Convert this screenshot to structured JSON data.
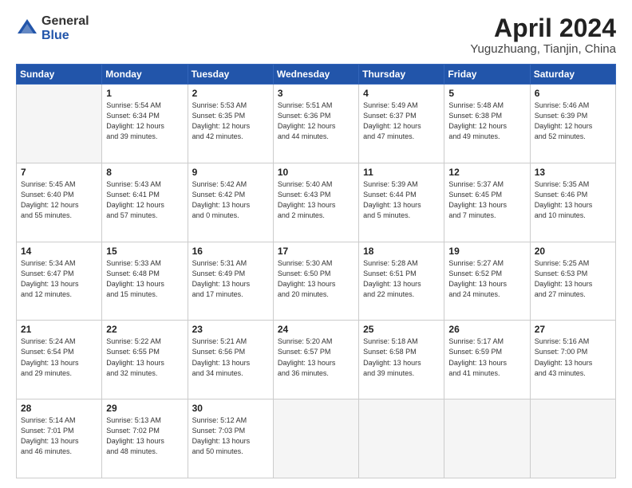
{
  "logo": {
    "general": "General",
    "blue": "Blue"
  },
  "title": "April 2024",
  "location": "Yuguzhuang, Tianjin, China",
  "weekdays": [
    "Sunday",
    "Monday",
    "Tuesday",
    "Wednesday",
    "Thursday",
    "Friday",
    "Saturday"
  ],
  "weeks": [
    [
      {
        "day": "",
        "info": ""
      },
      {
        "day": "1",
        "info": "Sunrise: 5:54 AM\nSunset: 6:34 PM\nDaylight: 12 hours\nand 39 minutes."
      },
      {
        "day": "2",
        "info": "Sunrise: 5:53 AM\nSunset: 6:35 PM\nDaylight: 12 hours\nand 42 minutes."
      },
      {
        "day": "3",
        "info": "Sunrise: 5:51 AM\nSunset: 6:36 PM\nDaylight: 12 hours\nand 44 minutes."
      },
      {
        "day": "4",
        "info": "Sunrise: 5:49 AM\nSunset: 6:37 PM\nDaylight: 12 hours\nand 47 minutes."
      },
      {
        "day": "5",
        "info": "Sunrise: 5:48 AM\nSunset: 6:38 PM\nDaylight: 12 hours\nand 49 minutes."
      },
      {
        "day": "6",
        "info": "Sunrise: 5:46 AM\nSunset: 6:39 PM\nDaylight: 12 hours\nand 52 minutes."
      }
    ],
    [
      {
        "day": "7",
        "info": "Sunrise: 5:45 AM\nSunset: 6:40 PM\nDaylight: 12 hours\nand 55 minutes."
      },
      {
        "day": "8",
        "info": "Sunrise: 5:43 AM\nSunset: 6:41 PM\nDaylight: 12 hours\nand 57 minutes."
      },
      {
        "day": "9",
        "info": "Sunrise: 5:42 AM\nSunset: 6:42 PM\nDaylight: 13 hours\nand 0 minutes."
      },
      {
        "day": "10",
        "info": "Sunrise: 5:40 AM\nSunset: 6:43 PM\nDaylight: 13 hours\nand 2 minutes."
      },
      {
        "day": "11",
        "info": "Sunrise: 5:39 AM\nSunset: 6:44 PM\nDaylight: 13 hours\nand 5 minutes."
      },
      {
        "day": "12",
        "info": "Sunrise: 5:37 AM\nSunset: 6:45 PM\nDaylight: 13 hours\nand 7 minutes."
      },
      {
        "day": "13",
        "info": "Sunrise: 5:35 AM\nSunset: 6:46 PM\nDaylight: 13 hours\nand 10 minutes."
      }
    ],
    [
      {
        "day": "14",
        "info": "Sunrise: 5:34 AM\nSunset: 6:47 PM\nDaylight: 13 hours\nand 12 minutes."
      },
      {
        "day": "15",
        "info": "Sunrise: 5:33 AM\nSunset: 6:48 PM\nDaylight: 13 hours\nand 15 minutes."
      },
      {
        "day": "16",
        "info": "Sunrise: 5:31 AM\nSunset: 6:49 PM\nDaylight: 13 hours\nand 17 minutes."
      },
      {
        "day": "17",
        "info": "Sunrise: 5:30 AM\nSunset: 6:50 PM\nDaylight: 13 hours\nand 20 minutes."
      },
      {
        "day": "18",
        "info": "Sunrise: 5:28 AM\nSunset: 6:51 PM\nDaylight: 13 hours\nand 22 minutes."
      },
      {
        "day": "19",
        "info": "Sunrise: 5:27 AM\nSunset: 6:52 PM\nDaylight: 13 hours\nand 24 minutes."
      },
      {
        "day": "20",
        "info": "Sunrise: 5:25 AM\nSunset: 6:53 PM\nDaylight: 13 hours\nand 27 minutes."
      }
    ],
    [
      {
        "day": "21",
        "info": "Sunrise: 5:24 AM\nSunset: 6:54 PM\nDaylight: 13 hours\nand 29 minutes."
      },
      {
        "day": "22",
        "info": "Sunrise: 5:22 AM\nSunset: 6:55 PM\nDaylight: 13 hours\nand 32 minutes."
      },
      {
        "day": "23",
        "info": "Sunrise: 5:21 AM\nSunset: 6:56 PM\nDaylight: 13 hours\nand 34 minutes."
      },
      {
        "day": "24",
        "info": "Sunrise: 5:20 AM\nSunset: 6:57 PM\nDaylight: 13 hours\nand 36 minutes."
      },
      {
        "day": "25",
        "info": "Sunrise: 5:18 AM\nSunset: 6:58 PM\nDaylight: 13 hours\nand 39 minutes."
      },
      {
        "day": "26",
        "info": "Sunrise: 5:17 AM\nSunset: 6:59 PM\nDaylight: 13 hours\nand 41 minutes."
      },
      {
        "day": "27",
        "info": "Sunrise: 5:16 AM\nSunset: 7:00 PM\nDaylight: 13 hours\nand 43 minutes."
      }
    ],
    [
      {
        "day": "28",
        "info": "Sunrise: 5:14 AM\nSunset: 7:01 PM\nDaylight: 13 hours\nand 46 minutes."
      },
      {
        "day": "29",
        "info": "Sunrise: 5:13 AM\nSunset: 7:02 PM\nDaylight: 13 hours\nand 48 minutes."
      },
      {
        "day": "30",
        "info": "Sunrise: 5:12 AM\nSunset: 7:03 PM\nDaylight: 13 hours\nand 50 minutes."
      },
      {
        "day": "",
        "info": ""
      },
      {
        "day": "",
        "info": ""
      },
      {
        "day": "",
        "info": ""
      },
      {
        "day": "",
        "info": ""
      }
    ]
  ]
}
